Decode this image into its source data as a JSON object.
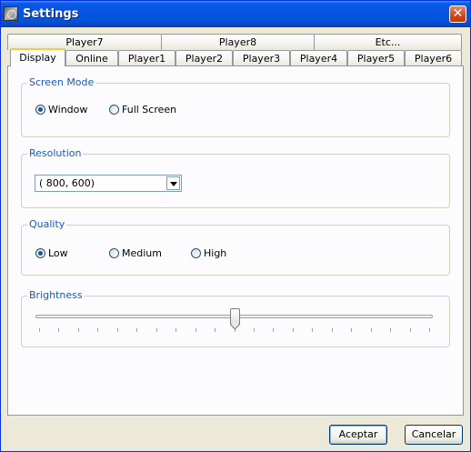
{
  "window": {
    "title": "Settings"
  },
  "tabs": {
    "back_row": [
      "Player7",
      "Player8",
      "Etc..."
    ],
    "front_row": [
      "Display",
      "Online",
      "Player1",
      "Player2",
      "Player3",
      "Player4",
      "Player5",
      "Player6"
    ],
    "active": "Display"
  },
  "screen_mode": {
    "label": "Screen Mode",
    "options": [
      {
        "label": "Window",
        "checked": true
      },
      {
        "label": "Full Screen",
        "checked": false
      }
    ]
  },
  "resolution": {
    "label": "Resolution",
    "value": "( 800, 600)"
  },
  "quality": {
    "label": "Quality",
    "options": [
      {
        "label": "Low",
        "checked": true
      },
      {
        "label": "Medium",
        "checked": false
      },
      {
        "label": "High",
        "checked": false
      }
    ]
  },
  "brightness": {
    "label": "Brightness",
    "level_fraction": 0.5,
    "tick_count": 21
  },
  "buttons": {
    "accept": "Aceptar",
    "cancel": "Cancelar"
  }
}
